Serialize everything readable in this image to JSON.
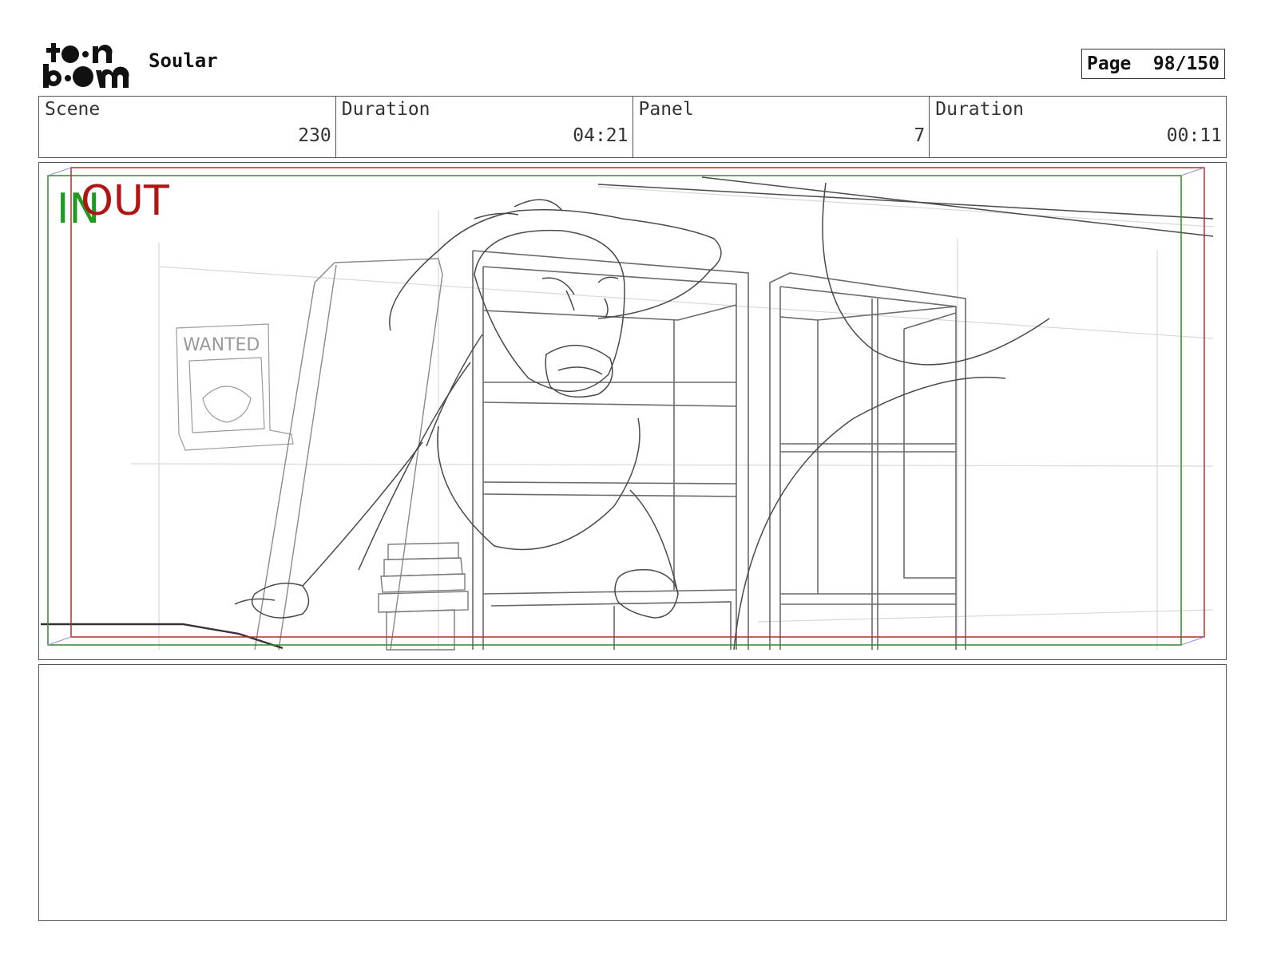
{
  "header": {
    "logo_text": "toon boom",
    "project_title": "Soular",
    "page_label": "Page",
    "page_number": "98/150"
  },
  "info_bar": [
    {
      "label": "Scene",
      "value": "230"
    },
    {
      "label": "Duration",
      "value": "04:21"
    },
    {
      "label": "Panel",
      "value": "7"
    },
    {
      "label": "Duration",
      "value": "00:11"
    }
  ],
  "panel": {
    "in_marker": "IN",
    "out_marker": "OUT",
    "poster_text": "WANTED",
    "colors": {
      "in_frame": "#2e8b2e",
      "out_frame": "#c0282c",
      "sketch": "#555555"
    }
  },
  "notes": {
    "text": ""
  }
}
